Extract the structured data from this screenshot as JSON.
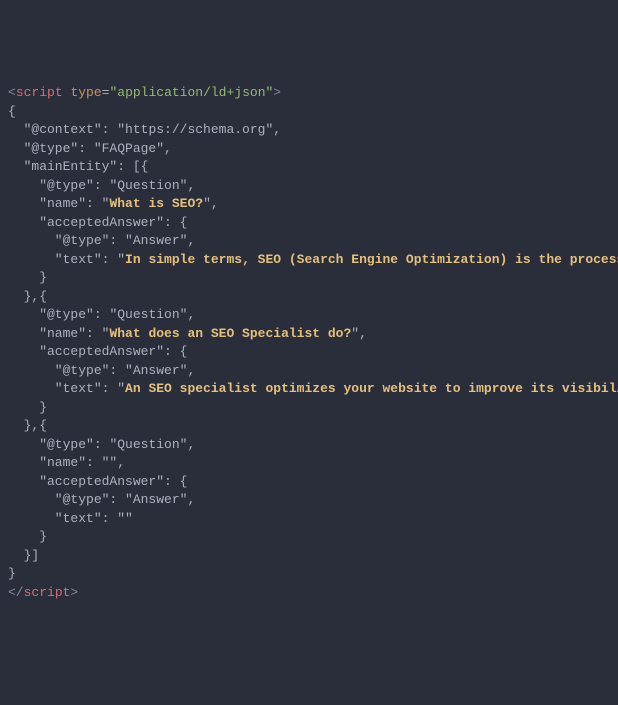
{
  "open_tag": {
    "lt": "<",
    "name": "script",
    "attr": "type",
    "eq": "=",
    "val": "\"application/ld+json\"",
    "gt": ">"
  },
  "close_tag": {
    "lt": "</",
    "name": "script",
    "gt": ">"
  },
  "lines": {
    "l1": "{",
    "l2k": "  \"@context\"",
    "l2c": ": ",
    "l2v": "\"https://schema.org\"",
    "l2p": ",",
    "l3k": "  \"@type\"",
    "l3c": ": ",
    "l3v": "\"FAQPage\"",
    "l3p": ",",
    "l4k": "  \"mainEntity\"",
    "l4c": ": [{",
    "l5k": "    \"@type\"",
    "l5c": ": ",
    "l5v": "\"Question\"",
    "l5p": ",",
    "l6k": "    \"name\"",
    "l6c": ": ",
    "l6q": "\"",
    "l6h": "What is SEO?",
    "l6q2": "\"",
    "l6p": ",",
    "l7k": "    \"acceptedAnswer\"",
    "l7c": ": {",
    "l8k": "      \"@type\"",
    "l8c": ": ",
    "l8v": "\"Answer\"",
    "l8p": ",",
    "l9k": "      \"text\"",
    "l9c": ": ",
    "l9q": "\"",
    "l9h": "In simple terms, SEO (Search Engine Optimization) is the process of ma",
    "l10": "    }",
    "l11": "  },{",
    "l12k": "    \"@type\"",
    "l12c": ": ",
    "l12v": "\"Question\"",
    "l12p": ",",
    "l13k": "    \"name\"",
    "l13c": ": ",
    "l13q": "\"",
    "l13h": "What does an SEO Specialist do?",
    "l13q2": "\"",
    "l13p": ",",
    "l14k": "    \"acceptedAnswer\"",
    "l14c": ": {",
    "l15k": "      \"@type\"",
    "l15c": ": ",
    "l15v": "\"Answer\"",
    "l15p": ",",
    "l16k": "      \"text\"",
    "l16c": ": ",
    "l16q": "\"",
    "l16h": "An SEO specialist optimizes your website to improve its visibility on ",
    "l17": "    }",
    "l18": "  },{",
    "l19k": "    \"@type\"",
    "l19c": ": ",
    "l19v": "\"Question\"",
    "l19p": ",",
    "l20k": "    \"name\"",
    "l20c": ": ",
    "l20v": "\"\"",
    "l20p": ",",
    "l21k": "    \"acceptedAnswer\"",
    "l21c": ": {",
    "l22k": "      \"@type\"",
    "l22c": ": ",
    "l22v": "\"Answer\"",
    "l22p": ",",
    "l23k": "      \"text\"",
    "l23c": ": ",
    "l23v": "\"\"",
    "l24": "    }",
    "l25": "  }]",
    "l26": "}"
  }
}
